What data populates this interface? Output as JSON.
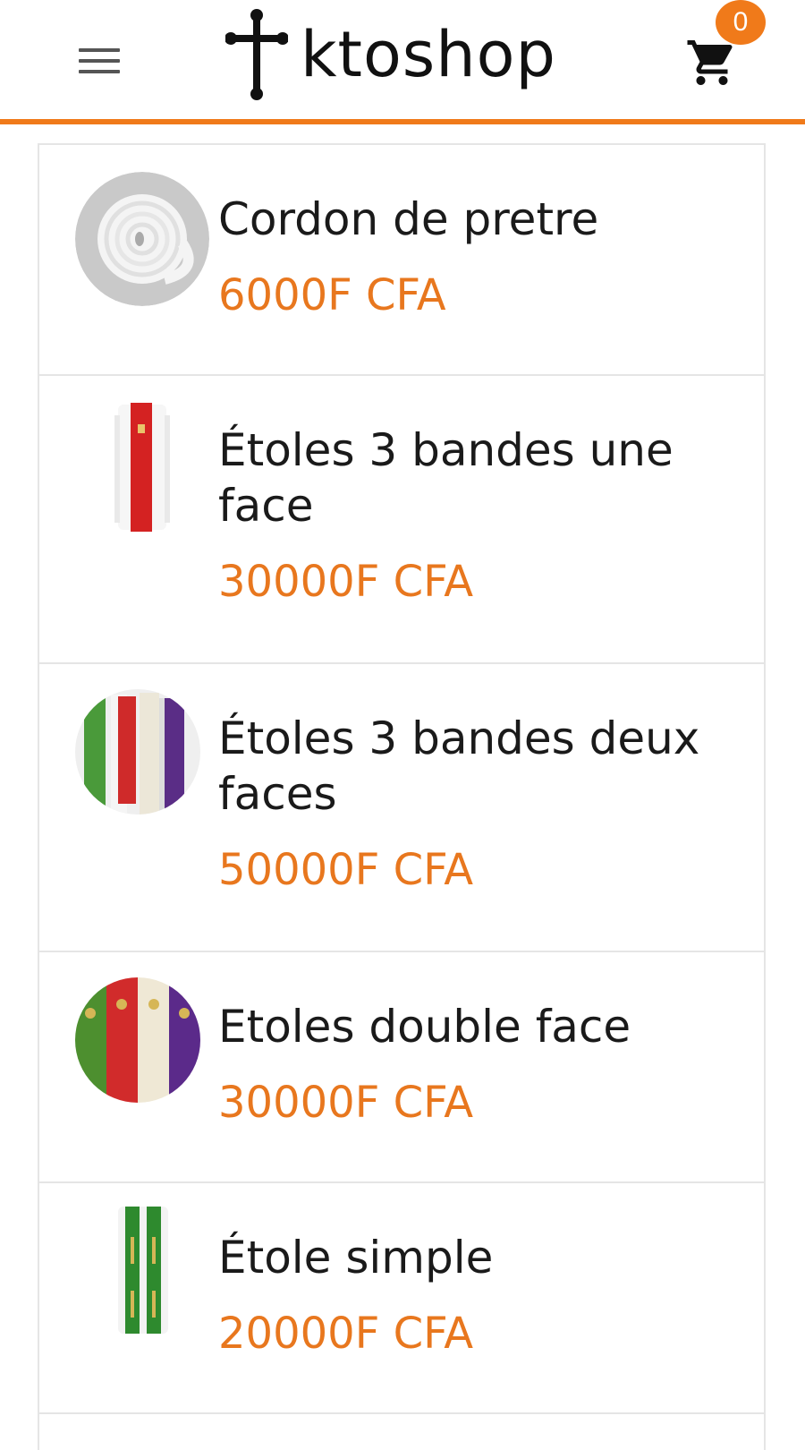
{
  "header": {
    "menu_icon": "hamburger-menu-icon",
    "logo_icon": "cross-icon",
    "logo_text": "ktoshop",
    "cart_icon": "shopping-cart-icon",
    "cart_count": "0"
  },
  "colors": {
    "accent": "#f07a1a",
    "price": "#e8771e",
    "text": "#1a1a1a",
    "border": "#e5e5e5"
  },
  "products": [
    {
      "name": "Cordon de pretre",
      "price": "6000F CFA"
    },
    {
      "name": "Étoles 3 bandes une face",
      "price": "30000F CFA"
    },
    {
      "name": "Étoles 3 bandes deux faces",
      "price": "50000F CFA"
    },
    {
      "name": "Etoles double face",
      "price": "30000F CFA"
    },
    {
      "name": "Étole simple",
      "price": "20000F CFA"
    }
  ]
}
